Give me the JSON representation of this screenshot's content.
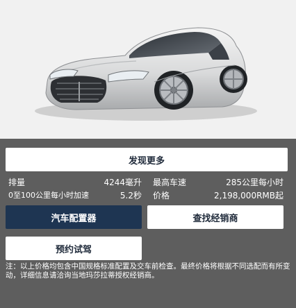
{
  "colors": {
    "panel_bg": "#5e5e5e",
    "hero_bg": "#f1f1f1",
    "primary_button": "#1e3552",
    "light_button": "#ffffff"
  },
  "hero": {
    "image": "maserati-granturismo-car-image"
  },
  "buttons": {
    "discover_more": "发现更多",
    "configurator": "汽车配置器",
    "find_dealer": "查找经销商",
    "book_test_drive": "预约试驾"
  },
  "specs": {
    "displacement_label": "排量",
    "displacement_value": "4244毫升",
    "top_speed_label": "最高车速",
    "top_speed_value": "285公里每小时",
    "accel_label": "0至100公里每小时加速",
    "accel_value": "5.2秒",
    "price_label": "价格",
    "price_value": "2,198,000RMB起"
  },
  "note": "注：以上价格均包含中国规格标准配置及交车前检查。最终价格将根据不同选配而有所变动，详细信息请洽询当地玛莎拉蒂授权经销商。"
}
